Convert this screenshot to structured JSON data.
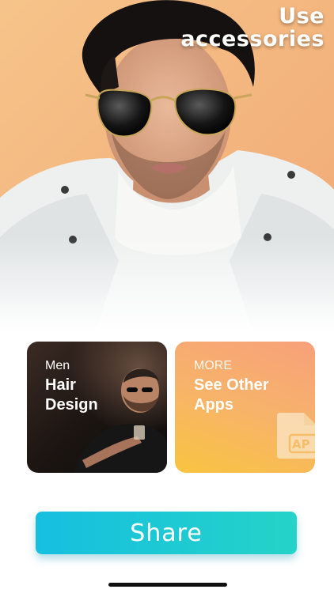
{
  "hero": {
    "title_line1": "Use",
    "title_line2": "accessories"
  },
  "cards": {
    "men": {
      "kicker": "Men",
      "title_line1": "Hair",
      "title_line2": "Design"
    },
    "more": {
      "kicker": "MORE",
      "title_line1": "See Other",
      "title_line2": "Apps",
      "file_icon_text": "AP"
    }
  },
  "share_label": "Share",
  "colors": {
    "share_start": "#16bfe0",
    "share_end": "#25d3c8",
    "more_card_start": "#f7a07a",
    "more_card_end": "#f9c440",
    "hero_bg": "#f3b77e"
  }
}
